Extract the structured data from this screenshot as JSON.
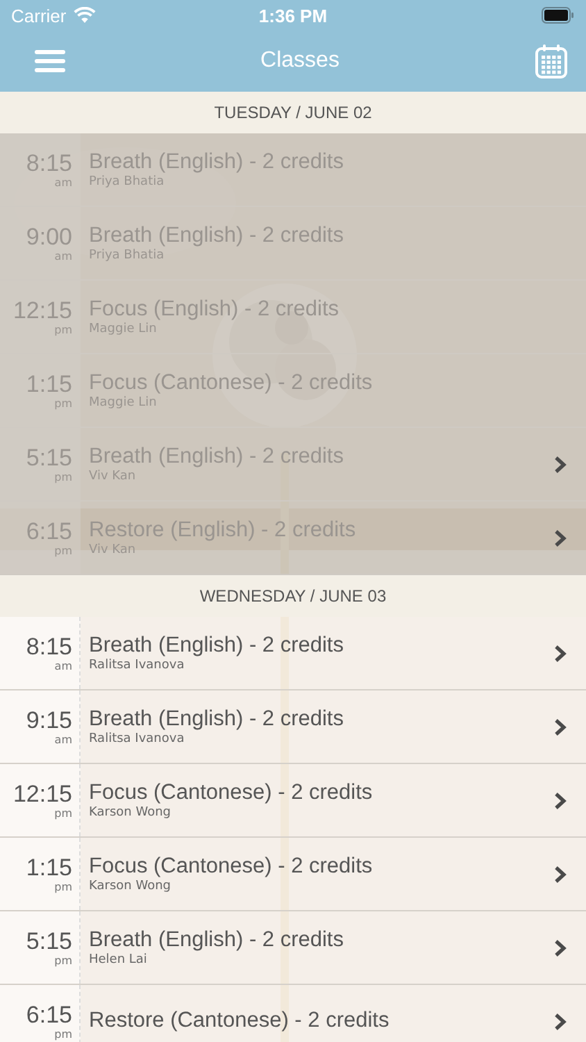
{
  "status_bar": {
    "carrier": "Carrier",
    "time": "1:36 PM"
  },
  "nav_bar": {
    "title": "Classes"
  },
  "sections": [
    {
      "header": "TUESDAY / JUNE 02",
      "classes": [
        {
          "time": "8:15",
          "meridiem": "am",
          "title": "Breath (English) - 2 credits",
          "instructor": "Priya Bhatia",
          "past": true,
          "has_detail": false
        },
        {
          "time": "9:00",
          "meridiem": "am",
          "title": "Breath (English) - 2 credits",
          "instructor": "Priya Bhatia",
          "past": true,
          "has_detail": false
        },
        {
          "time": "12:15",
          "meridiem": "pm",
          "title": "Focus (English) - 2 credits",
          "instructor": "Maggie Lin",
          "past": true,
          "has_detail": false
        },
        {
          "time": "1:15",
          "meridiem": "pm",
          "title": "Focus (Cantonese) - 2 credits",
          "instructor": "Maggie Lin",
          "past": true,
          "has_detail": false
        },
        {
          "time": "5:15",
          "meridiem": "pm",
          "title": "Breath (English) - 2 credits",
          "instructor": "Viv Kan",
          "past": true,
          "has_detail": true
        },
        {
          "time": "6:15",
          "meridiem": "pm",
          "title": "Restore (English) - 2 credits",
          "instructor": "Viv Kan",
          "past": true,
          "has_detail": true
        }
      ]
    },
    {
      "header": "WEDNESDAY / JUNE 03",
      "classes": [
        {
          "time": "8:15",
          "meridiem": "am",
          "title": "Breath (English) - 2 credits",
          "instructor": "Ralitsa Ivanova",
          "past": false,
          "has_detail": true
        },
        {
          "time": "9:15",
          "meridiem": "am",
          "title": "Breath (English) - 2 credits",
          "instructor": "Ralitsa Ivanova",
          "past": false,
          "has_detail": true
        },
        {
          "time": "12:15",
          "meridiem": "pm",
          "title": "Focus (Cantonese) - 2 credits",
          "instructor": "Karson Wong",
          "past": false,
          "has_detail": true
        },
        {
          "time": "1:15",
          "meridiem": "pm",
          "title": "Focus (Cantonese) - 2 credits",
          "instructor": "Karson Wong",
          "past": false,
          "has_detail": true
        },
        {
          "time": "5:15",
          "meridiem": "pm",
          "title": "Breath (English) - 2 credits",
          "instructor": "Helen Lai",
          "past": false,
          "has_detail": true
        },
        {
          "time": "6:15",
          "meridiem": "pm",
          "title": "Restore (Cantonese) - 2 credits",
          "past": false,
          "has_detail": true
        }
      ]
    }
  ]
}
